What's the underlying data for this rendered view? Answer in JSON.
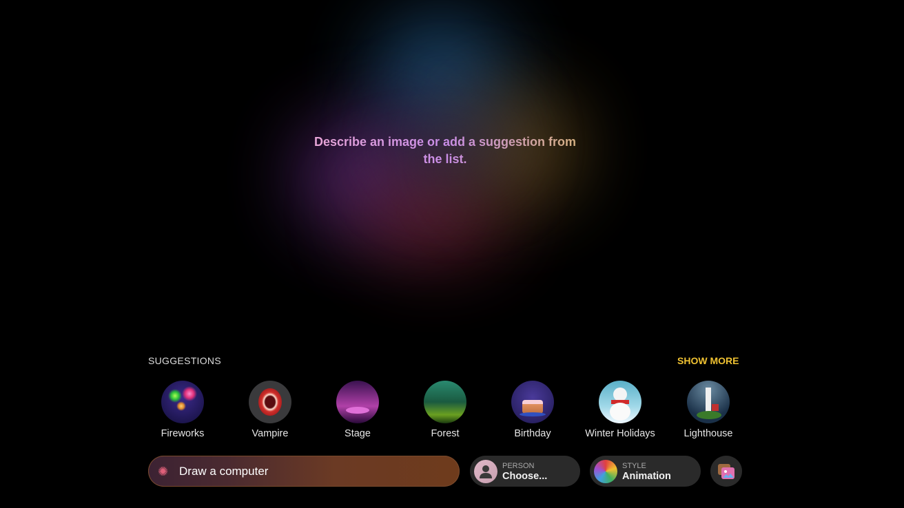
{
  "hint": "Describe an image or add a suggestion from the list.",
  "suggestions": {
    "title": "SUGGESTIONS",
    "show_more": "SHOW MORE",
    "items": [
      {
        "label": "Fireworks",
        "icon": "fireworks-thumbnail"
      },
      {
        "label": "Vampire",
        "icon": "vampire-thumbnail"
      },
      {
        "label": "Stage",
        "icon": "stage-thumbnail"
      },
      {
        "label": "Forest",
        "icon": "forest-thumbnail"
      },
      {
        "label": "Birthday",
        "icon": "birthday-thumbnail"
      },
      {
        "label": "Winter Holidays",
        "icon": "winter-holidays-thumbnail"
      },
      {
        "label": "Lighthouse",
        "icon": "lighthouse-thumbnail"
      }
    ]
  },
  "prompt": {
    "value": "Draw a computer",
    "icon": "image-playground-icon"
  },
  "person": {
    "key": "PERSON",
    "value": "Choose..."
  },
  "style": {
    "key": "STYLE",
    "value": "Animation"
  },
  "colors": {
    "accent": "#f0c232"
  }
}
